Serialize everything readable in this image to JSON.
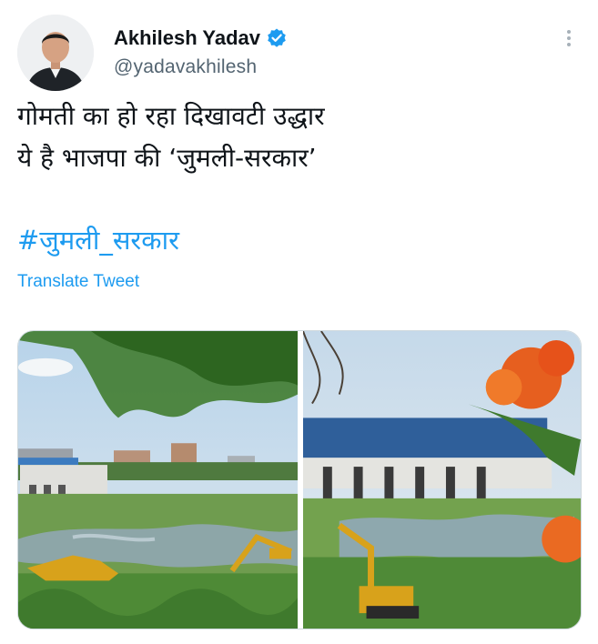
{
  "tweet": {
    "author": {
      "display_name": "Akhilesh Yadav",
      "handle": "@yadavakhilesh",
      "verified": true,
      "avatar_icon": "user-avatar"
    },
    "text_lines": [
      "गोमती का हो रहा दिखावटी उद्धार",
      "ये है भाजपा की ‘जुमली-सरकार’"
    ],
    "hashtag": "#जुमली_सरकार",
    "translate_label": "Translate Tweet",
    "media": {
      "count": 2,
      "photos": [
        {
          "description_icon": "river-excavator-photo"
        },
        {
          "description_icon": "barrage-flowers-photo"
        }
      ]
    }
  },
  "colors": {
    "accent": "#1d9bf0",
    "text": "#0f1419",
    "secondary_text": "#536471",
    "verified_badge": "#1d9bf0"
  }
}
